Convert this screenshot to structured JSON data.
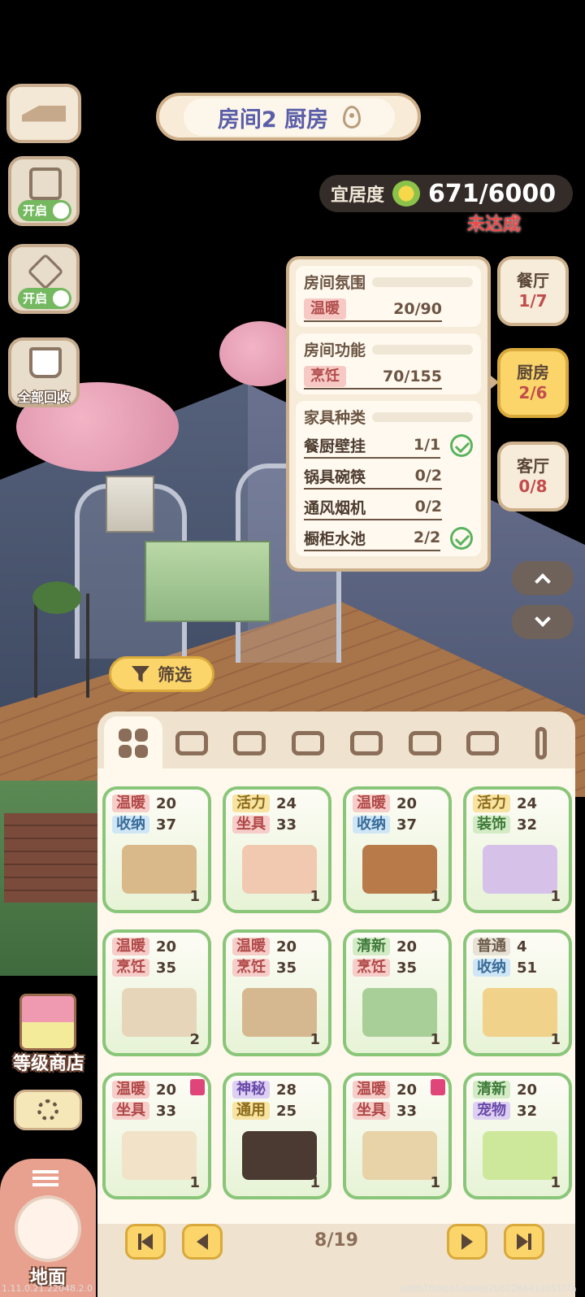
{
  "room": {
    "title": "房间2 厨房"
  },
  "side": {
    "toggle1": "开启",
    "toggle2": "开启",
    "recycle": "全部回收"
  },
  "livability": {
    "label": "宜居度",
    "value": "671/6000",
    "status": "未达成"
  },
  "panel": {
    "atmosphere": {
      "title": "房间氛围",
      "tag": "温暖",
      "value": "20/90"
    },
    "function": {
      "title": "房间功能",
      "tag": "烹饪",
      "value": "70/155"
    },
    "types": {
      "title": "家具种类",
      "items": [
        {
          "name": "餐厨壁挂",
          "value": "1/1",
          "done": true
        },
        {
          "name": "锅具碗筷",
          "value": "0/2",
          "done": false
        },
        {
          "name": "通风烟机",
          "value": "0/2",
          "done": false
        },
        {
          "name": "橱柜水池",
          "value": "2/2",
          "done": true
        }
      ]
    }
  },
  "room_tabs": [
    {
      "name": "餐厅",
      "count": "1/7",
      "active": false
    },
    {
      "name": "厨房",
      "count": "2/6",
      "active": true
    },
    {
      "name": "客厅",
      "count": "0/8",
      "active": false
    }
  ],
  "filter": {
    "label": "筛选"
  },
  "categories": [
    "all-icon",
    "sofa-icon",
    "table-icon",
    "bed-icon",
    "wardrobe-icon",
    "pot-icon",
    "toilet-icon",
    "lamp-icon"
  ],
  "items": [
    {
      "s1": "温暖",
      "v1": "20",
      "s2": "收纳",
      "v2": "37",
      "qty": "1",
      "badge": false
    },
    {
      "s1": "活力",
      "v1": "24",
      "s2": "坐具",
      "v2": "33",
      "qty": "1",
      "badge": false
    },
    {
      "s1": "温暖",
      "v1": "20",
      "s2": "收纳",
      "v2": "37",
      "qty": "1",
      "badge": false
    },
    {
      "s1": "活力",
      "v1": "24",
      "s2": "装饰",
      "v2": "32",
      "qty": "1",
      "badge": false
    },
    {
      "s1": "温暖",
      "v1": "20",
      "s2": "烹饪",
      "v2": "35",
      "qty": "2",
      "badge": false
    },
    {
      "s1": "温暖",
      "v1": "20",
      "s2": "烹饪",
      "v2": "35",
      "qty": "1",
      "badge": false
    },
    {
      "s1": "清新",
      "v1": "20",
      "s2": "烹饪",
      "v2": "35",
      "qty": "1",
      "badge": false
    },
    {
      "s1": "普通",
      "v1": "4",
      "s2": "收纳",
      "v2": "51",
      "qty": "1",
      "badge": false
    },
    {
      "s1": "温暖",
      "v1": "20",
      "s2": "坐具",
      "v2": "33",
      "qty": "1",
      "badge": true
    },
    {
      "s1": "神秘",
      "v1": "28",
      "s2": "通用",
      "v2": "25",
      "qty": "1",
      "badge": false
    },
    {
      "s1": "温暖",
      "v1": "20",
      "s2": "坐具",
      "v2": "33",
      "qty": "1",
      "badge": true
    },
    {
      "s1": "清新",
      "v1": "20",
      "s2": "宠物",
      "v2": "32",
      "qty": "1",
      "badge": false
    }
  ],
  "tag_colors": {
    "温暖": [
      "#f6cdc8",
      "#b04848"
    ],
    "活力": [
      "#f8e3a0",
      "#8a6a1c"
    ],
    "清新": [
      "#d3ecc6",
      "#3f7a3a"
    ],
    "普通": [
      "#e8e2d6",
      "#6b5b4b"
    ],
    "神秘": [
      "#ddd0f3",
      "#6a4aa8"
    ],
    "收纳": [
      "#cfe6f7",
      "#3a6c98"
    ],
    "坐具": [
      "#f6cdc8",
      "#b04848"
    ],
    "装饰": [
      "#d3ecc6",
      "#3f7a3a"
    ],
    "烹饪": [
      "#f6cdc8",
      "#b04848"
    ],
    "通用": [
      "#f8e3a0",
      "#8a6a1c"
    ],
    "宠物": [
      "#ddd0f3",
      "#6a4aa8"
    ]
  },
  "item_colors": [
    "#d9b98a",
    "#f0c9b0",
    "#b97a4a",
    "#d6c2e8",
    "#e6d5b8",
    "#d5b88f",
    "#a9cf98",
    "#f0d28a",
    "#f2e3c8",
    "#4a3a32",
    "#e8d2a8",
    "#cde89a"
  ],
  "pager": {
    "page": "8/19"
  },
  "shop": {
    "label": "等级商店"
  },
  "mode": {
    "label": "地面"
  },
  "footer": {
    "version": "1.11.0.21.22048.2.0",
    "hash": "bd8b1fb9bb1dde0e2b6226641a051f7a"
  }
}
